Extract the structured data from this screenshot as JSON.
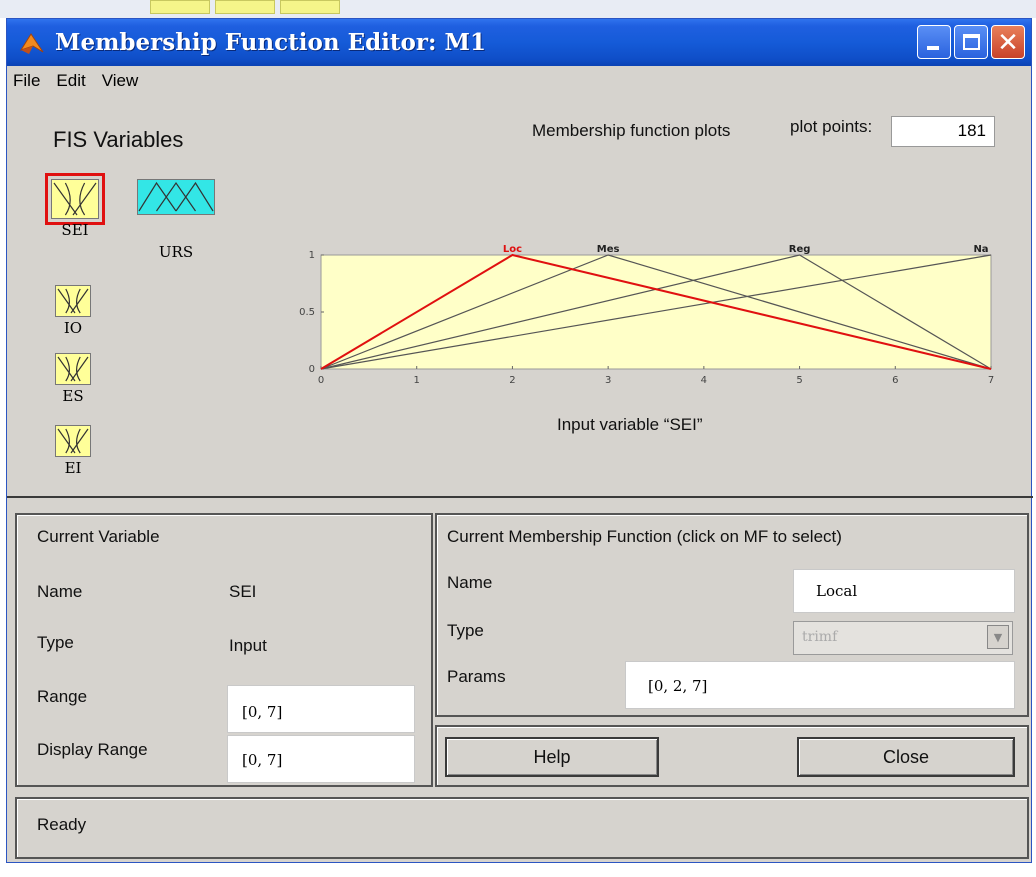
{
  "window": {
    "title": "Membership Function Editor: M1"
  },
  "menu": [
    "File",
    "Edit",
    "View"
  ],
  "fis": {
    "title": "FIS Variables",
    "variables": [
      {
        "name": "SEI",
        "selected": true,
        "color": "#ffff99"
      },
      {
        "name": "URS",
        "selected": false,
        "color": "#33e6e6"
      },
      {
        "name": "IO",
        "selected": false,
        "color": "#ffff99"
      },
      {
        "name": "ES",
        "selected": false,
        "color": "#ffff99"
      },
      {
        "name": "EI",
        "selected": false,
        "color": "#ffff99"
      }
    ]
  },
  "plot_header": {
    "mf_plots_label": "Membership function plots",
    "plot_points_label": "plot points:",
    "plot_points_value": "181"
  },
  "chart_data": {
    "type": "line",
    "xlim": [
      0,
      7
    ],
    "ylim": [
      0,
      1
    ],
    "xticks": [
      "0",
      "1",
      "2",
      "3",
      "4",
      "5",
      "6",
      "7"
    ],
    "yticks": [
      "0",
      "0.5",
      "1"
    ],
    "xlabel": "Input variable “SEI”",
    "background": "#ffffc8",
    "series": [
      {
        "name": "Loc",
        "params": [
          0,
          2,
          7
        ],
        "color": "#e01010",
        "selected": true
      },
      {
        "name": "Mes",
        "params": [
          0,
          3,
          7
        ],
        "color": "#555555",
        "selected": false
      },
      {
        "name": "Reg",
        "params": [
          0,
          5,
          7
        ],
        "color": "#555555",
        "selected": false
      },
      {
        "name": "Na",
        "params": [
          0,
          7,
          7
        ],
        "color": "#555555",
        "selected": false
      }
    ]
  },
  "current_variable": {
    "title": "Current Variable",
    "name_label": "Name",
    "name_value": "SEI",
    "type_label": "Type",
    "type_value": "Input",
    "range_label": "Range",
    "range_value": "[0, 7]",
    "display_range_label": "Display Range",
    "display_range_value": "[0, 7]"
  },
  "current_mf": {
    "title": "Current Membership Function (click on MF to select)",
    "name_label": "Name",
    "name_value": "Local",
    "type_label": "Type",
    "type_value": "trimf",
    "params_label": "Params",
    "params_value": "[0, 2, 7]"
  },
  "buttons": {
    "help": "Help",
    "close": "Close"
  },
  "status": {
    "text": "Ready"
  }
}
